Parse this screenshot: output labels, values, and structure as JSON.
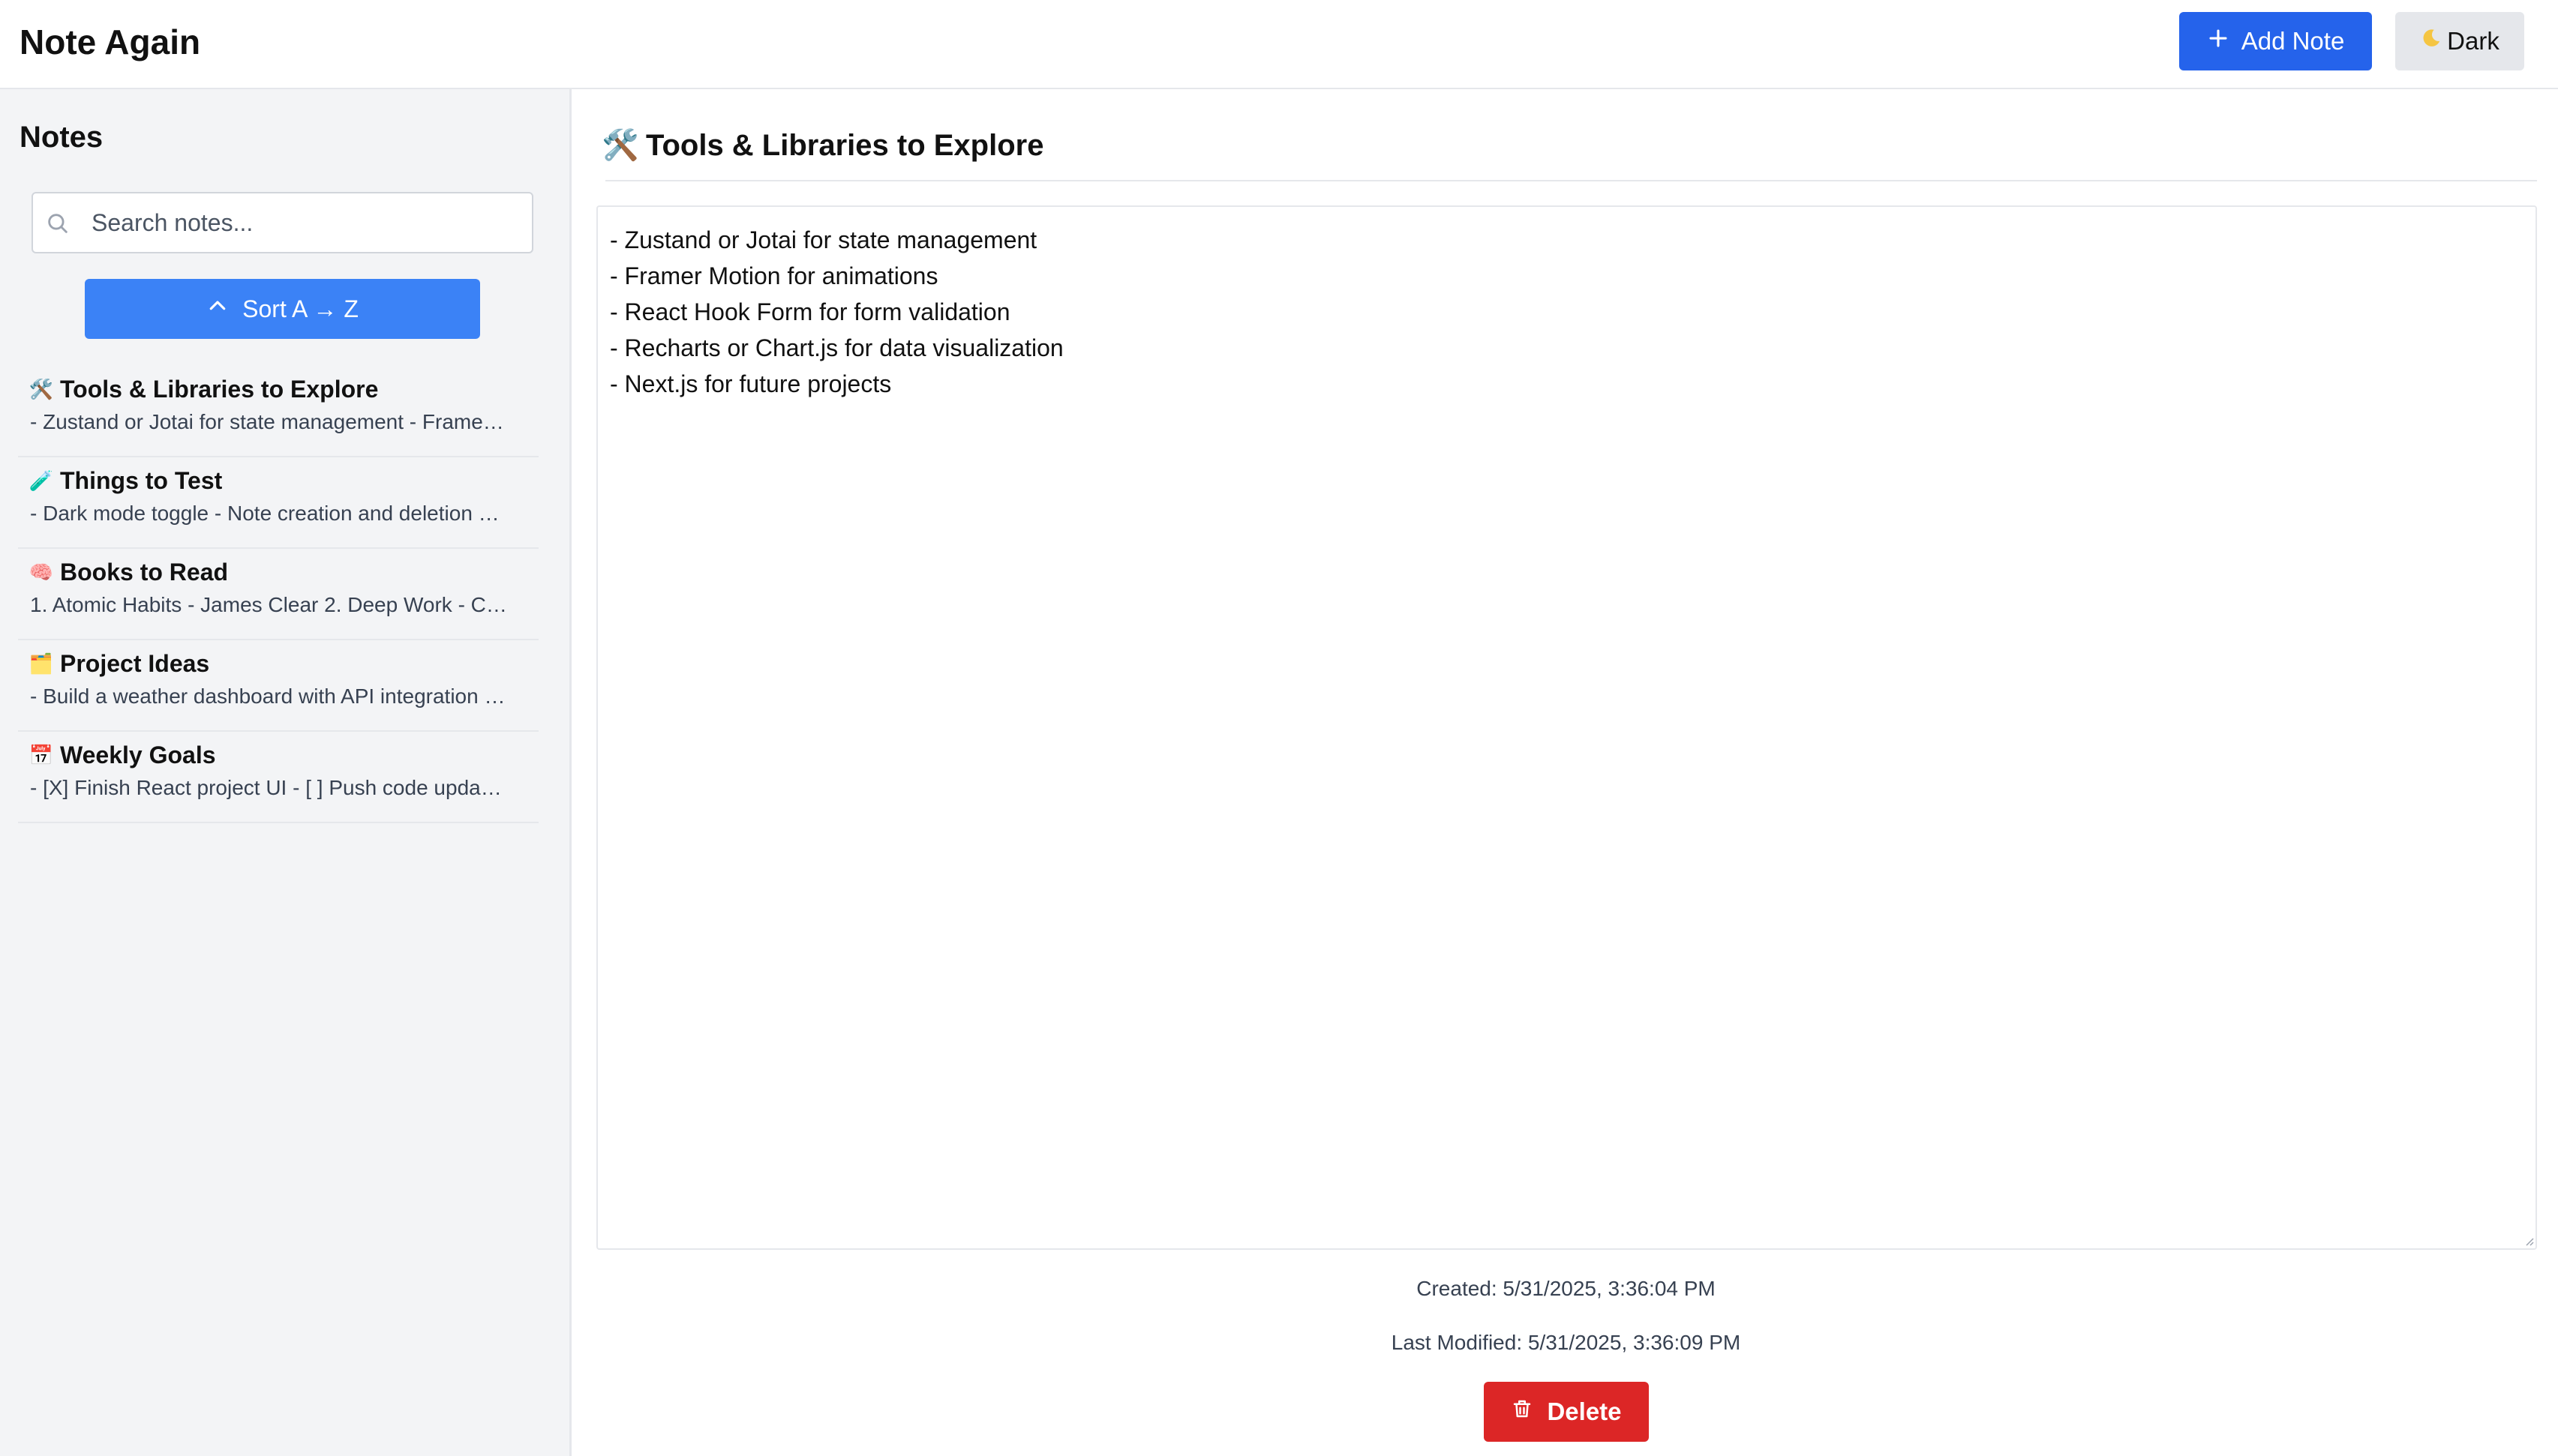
{
  "app": {
    "title": "Note Again"
  },
  "header": {
    "add_note_label": "Add Note",
    "dark_label": "Dark"
  },
  "sidebar": {
    "title": "Notes",
    "search": {
      "placeholder": "Search notes...",
      "value": ""
    },
    "sort_label": "Sort A → Z",
    "notes": [
      {
        "emoji": "🛠️",
        "title": "Tools & Libraries to Explore",
        "preview": "- Zustand or Jotai for state management - Frame…"
      },
      {
        "emoji": "🧪",
        "title": "Things to Test",
        "preview": "- Dark mode toggle - Note creation and deletion …"
      },
      {
        "emoji": "🧠",
        "title": "Books to Read",
        "preview": "1. Atomic Habits - James Clear 2. Deep Work - C…"
      },
      {
        "emoji": "🗂️",
        "title": "Project Ideas",
        "preview": "- Build a weather dashboard with API integration …"
      },
      {
        "emoji": "📅",
        "title": "Weekly Goals",
        "preview": "- [X] Finish React project UI - [ ] Push code upda…"
      }
    ]
  },
  "editor": {
    "emoji": "🛠️",
    "title": "Tools & Libraries to Explore",
    "content": "- Zustand or Jotai for state management\n- Framer Motion for animations\n- React Hook Form for form validation\n- Recharts or Chart.js for data visualization\n- Next.js for future projects",
    "created": "Created: 5/31/2025, 3:36:04 PM",
    "modified": "Last Modified: 5/31/2025, 3:36:09 PM",
    "delete_label": "Delete"
  },
  "icons": {
    "add": "plus-icon",
    "dark": "moon-icon",
    "search": "search-icon",
    "sort": "chevron-up-icon",
    "delete": "trash-icon"
  },
  "colors": {
    "primary": "#2563eb",
    "sort": "#3b82f6",
    "danger": "#dc2626",
    "sidebar_bg": "#f3f4f6"
  }
}
